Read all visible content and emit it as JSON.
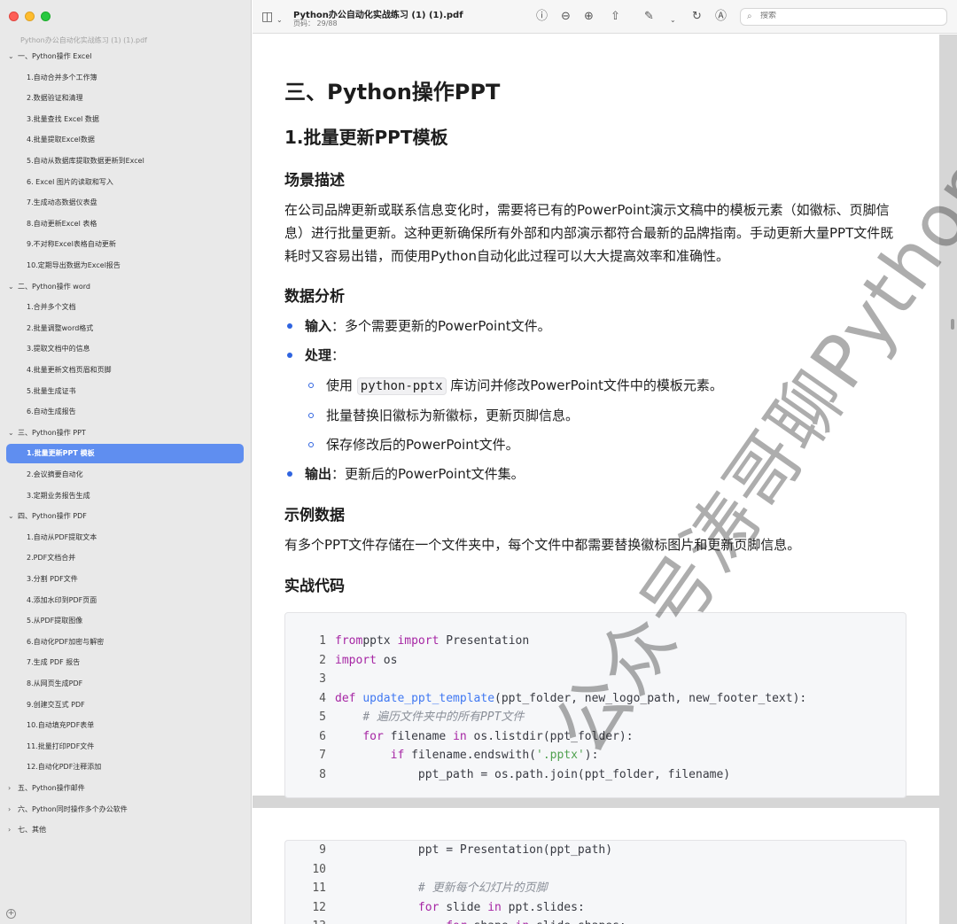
{
  "window": {
    "title": "Python办公自动化实战练习 (1) (1).pdf",
    "page_indicator": "页码： 29/88"
  },
  "toolbar": {
    "search_placeholder": "搜索"
  },
  "sidebar": {
    "doc_title": "Python办公自动化实战练习 (1) (1).pdf",
    "items": [
      {
        "label": "一、Python操作 Excel",
        "level": 0,
        "chevron": "⌄"
      },
      {
        "label": "1.自动合并多个工作簿",
        "level": 1
      },
      {
        "label": "2.数据验证和清理",
        "level": 1
      },
      {
        "label": "3.批量查找 Excel 数据",
        "level": 1
      },
      {
        "label": "4.批量提取Excel数据",
        "level": 1
      },
      {
        "label": "5.自动从数据库提取数据更新到Excel",
        "level": 1
      },
      {
        "label": "6. Excel 图片的读取和写入",
        "level": 1
      },
      {
        "label": "7.生成动态数据仪表盘",
        "level": 1
      },
      {
        "label": "8.自动更新Excel 表格",
        "level": 1
      },
      {
        "label": "9.不对称Excel表格自动更新",
        "level": 1
      },
      {
        "label": "10.定期导出数据为Excel报告",
        "level": 1
      },
      {
        "label": "二、Python操作 word",
        "level": 0,
        "chevron": "⌄"
      },
      {
        "label": "1.合并多个文档",
        "level": 1
      },
      {
        "label": "2.批量调整word格式",
        "level": 1
      },
      {
        "label": "3.提取文档中的信息",
        "level": 1
      },
      {
        "label": "4.批量更新文档页眉和页脚",
        "level": 1
      },
      {
        "label": "5.批量生成证书",
        "level": 1
      },
      {
        "label": "6.自动生成报告",
        "level": 1
      },
      {
        "label": "三、Python操作 PPT",
        "level": 0,
        "chevron": "⌄"
      },
      {
        "label": "1.批量更新PPT 模板",
        "level": 1,
        "active": true
      },
      {
        "label": "2.会议摘要自动化",
        "level": 1
      },
      {
        "label": "3.定期业务报告生成",
        "level": 1
      },
      {
        "label": "四、Python操作 PDF",
        "level": 0,
        "chevron": "⌄"
      },
      {
        "label": "1.自动从PDF提取文本",
        "level": 1
      },
      {
        "label": "2.PDF文档合并",
        "level": 1
      },
      {
        "label": "3.分割 PDF文件",
        "level": 1
      },
      {
        "label": "4.添加水印到PDF页面",
        "level": 1
      },
      {
        "label": "5.从PDF提取图像",
        "level": 1
      },
      {
        "label": "6.自动化PDF加密与解密",
        "level": 1
      },
      {
        "label": "7.生成 PDF 报告",
        "level": 1
      },
      {
        "label": "8.从网页生成PDF",
        "level": 1
      },
      {
        "label": "9.创建交互式 PDF",
        "level": 1
      },
      {
        "label": "10.自动填充PDF表单",
        "level": 1
      },
      {
        "label": "11.批量打印PDF文件",
        "level": 1
      },
      {
        "label": "12.自动化PDF注释添加",
        "level": 1
      },
      {
        "label": "五、Python操作邮件",
        "level": 0,
        "chevron": "›"
      },
      {
        "label": "六、Python同时操作多个办公软件",
        "level": 0,
        "chevron": "›"
      },
      {
        "label": "七、其他",
        "level": 0,
        "chevron": "›"
      }
    ]
  },
  "document": {
    "h1": "三、Python操作PPT",
    "h2": "1.批量更新PPT模板",
    "scene_heading": "场景描述",
    "scene_text": "在公司品牌更新或联系信息变化时，需要将已有的PowerPoint演示文稿中的模板元素（如徽标、页脚信息）进行批量更新。这种更新确保所有外部和内部演示都符合最新的品牌指南。手动更新大量PPT文件既耗时又容易出错，而使用Python自动化此过程可以大大提高效率和准确性。",
    "analysis_heading": "数据分析",
    "input_label": "输入",
    "input_text": "：多个需要更新的PowerPoint文件。",
    "process_label": "处理",
    "process_colon": "：",
    "sub1_pre": "使用",
    "sub1_code": "python-pptx",
    "sub1_post": "库访问并修改PowerPoint文件中的模板元素。",
    "sub2": "批量替换旧徽标为新徽标，更新页脚信息。",
    "sub3": "保存修改后的PowerPoint文件。",
    "output_label": "输出",
    "output_text": "：更新后的PowerPoint文件集。",
    "sample_heading": "示例数据",
    "sample_text": "有多个PPT文件存储在一个文件夹中，每个文件中都需要替换徽标图片和更新页脚信息。",
    "code_heading": "实战代码"
  },
  "code_page1": [
    {
      "n": "1",
      "tokens": [
        [
          "kw",
          "from"
        ],
        [
          "",
          "pptx "
        ],
        [
          "kw",
          "import"
        ],
        [
          "",
          " Presentation"
        ]
      ]
    },
    {
      "n": "2",
      "tokens": [
        [
          "kw",
          "import"
        ],
        [
          "",
          " os"
        ]
      ]
    },
    {
      "n": "3",
      "tokens": []
    },
    {
      "n": "4",
      "tokens": [
        [
          "kw",
          "def"
        ],
        [
          "",
          " "
        ],
        [
          "fn",
          "update_ppt_template"
        ],
        [
          "",
          "(ppt_folder, new_logo_path, new_footer_text):"
        ]
      ]
    },
    {
      "n": "5",
      "tokens": [
        [
          "",
          "    "
        ],
        [
          "cm",
          "# 遍历文件夹中的所有PPT文件"
        ]
      ]
    },
    {
      "n": "6",
      "tokens": [
        [
          "",
          "    "
        ],
        [
          "kw",
          "for"
        ],
        [
          "",
          " filename "
        ],
        [
          "kw",
          "in"
        ],
        [
          "",
          " os.listdir(ppt_folder):"
        ]
      ]
    },
    {
      "n": "7",
      "tokens": [
        [
          "",
          "        "
        ],
        [
          "kw",
          "if"
        ],
        [
          "",
          " filename.endswith("
        ],
        [
          "st",
          "'.pptx'"
        ],
        [
          "",
          "):"
        ]
      ]
    },
    {
      "n": "8",
      "tokens": [
        [
          "",
          "            ppt_path = os.path.join(ppt_folder, filename)"
        ]
      ]
    }
  ],
  "code_page2": [
    {
      "n": "9",
      "tokens": [
        [
          "",
          "            ppt = Presentation(ppt_path)"
        ]
      ]
    },
    {
      "n": "10",
      "tokens": []
    },
    {
      "n": "11",
      "tokens": [
        [
          "",
          "            "
        ],
        [
          "cm",
          "# 更新每个幻灯片的页脚"
        ]
      ]
    },
    {
      "n": "12",
      "tokens": [
        [
          "",
          "            "
        ],
        [
          "kw",
          "for"
        ],
        [
          "",
          " slide "
        ],
        [
          "kw",
          "in"
        ],
        [
          "",
          " ppt.slides:"
        ]
      ]
    },
    {
      "n": "13",
      "tokens": [
        [
          "",
          "                "
        ],
        [
          "kw",
          "for"
        ],
        [
          "",
          " shape "
        ],
        [
          "kw",
          "in"
        ],
        [
          "",
          " slide.shapes:"
        ]
      ]
    }
  ],
  "watermark": "公众号涛哥聊Python"
}
